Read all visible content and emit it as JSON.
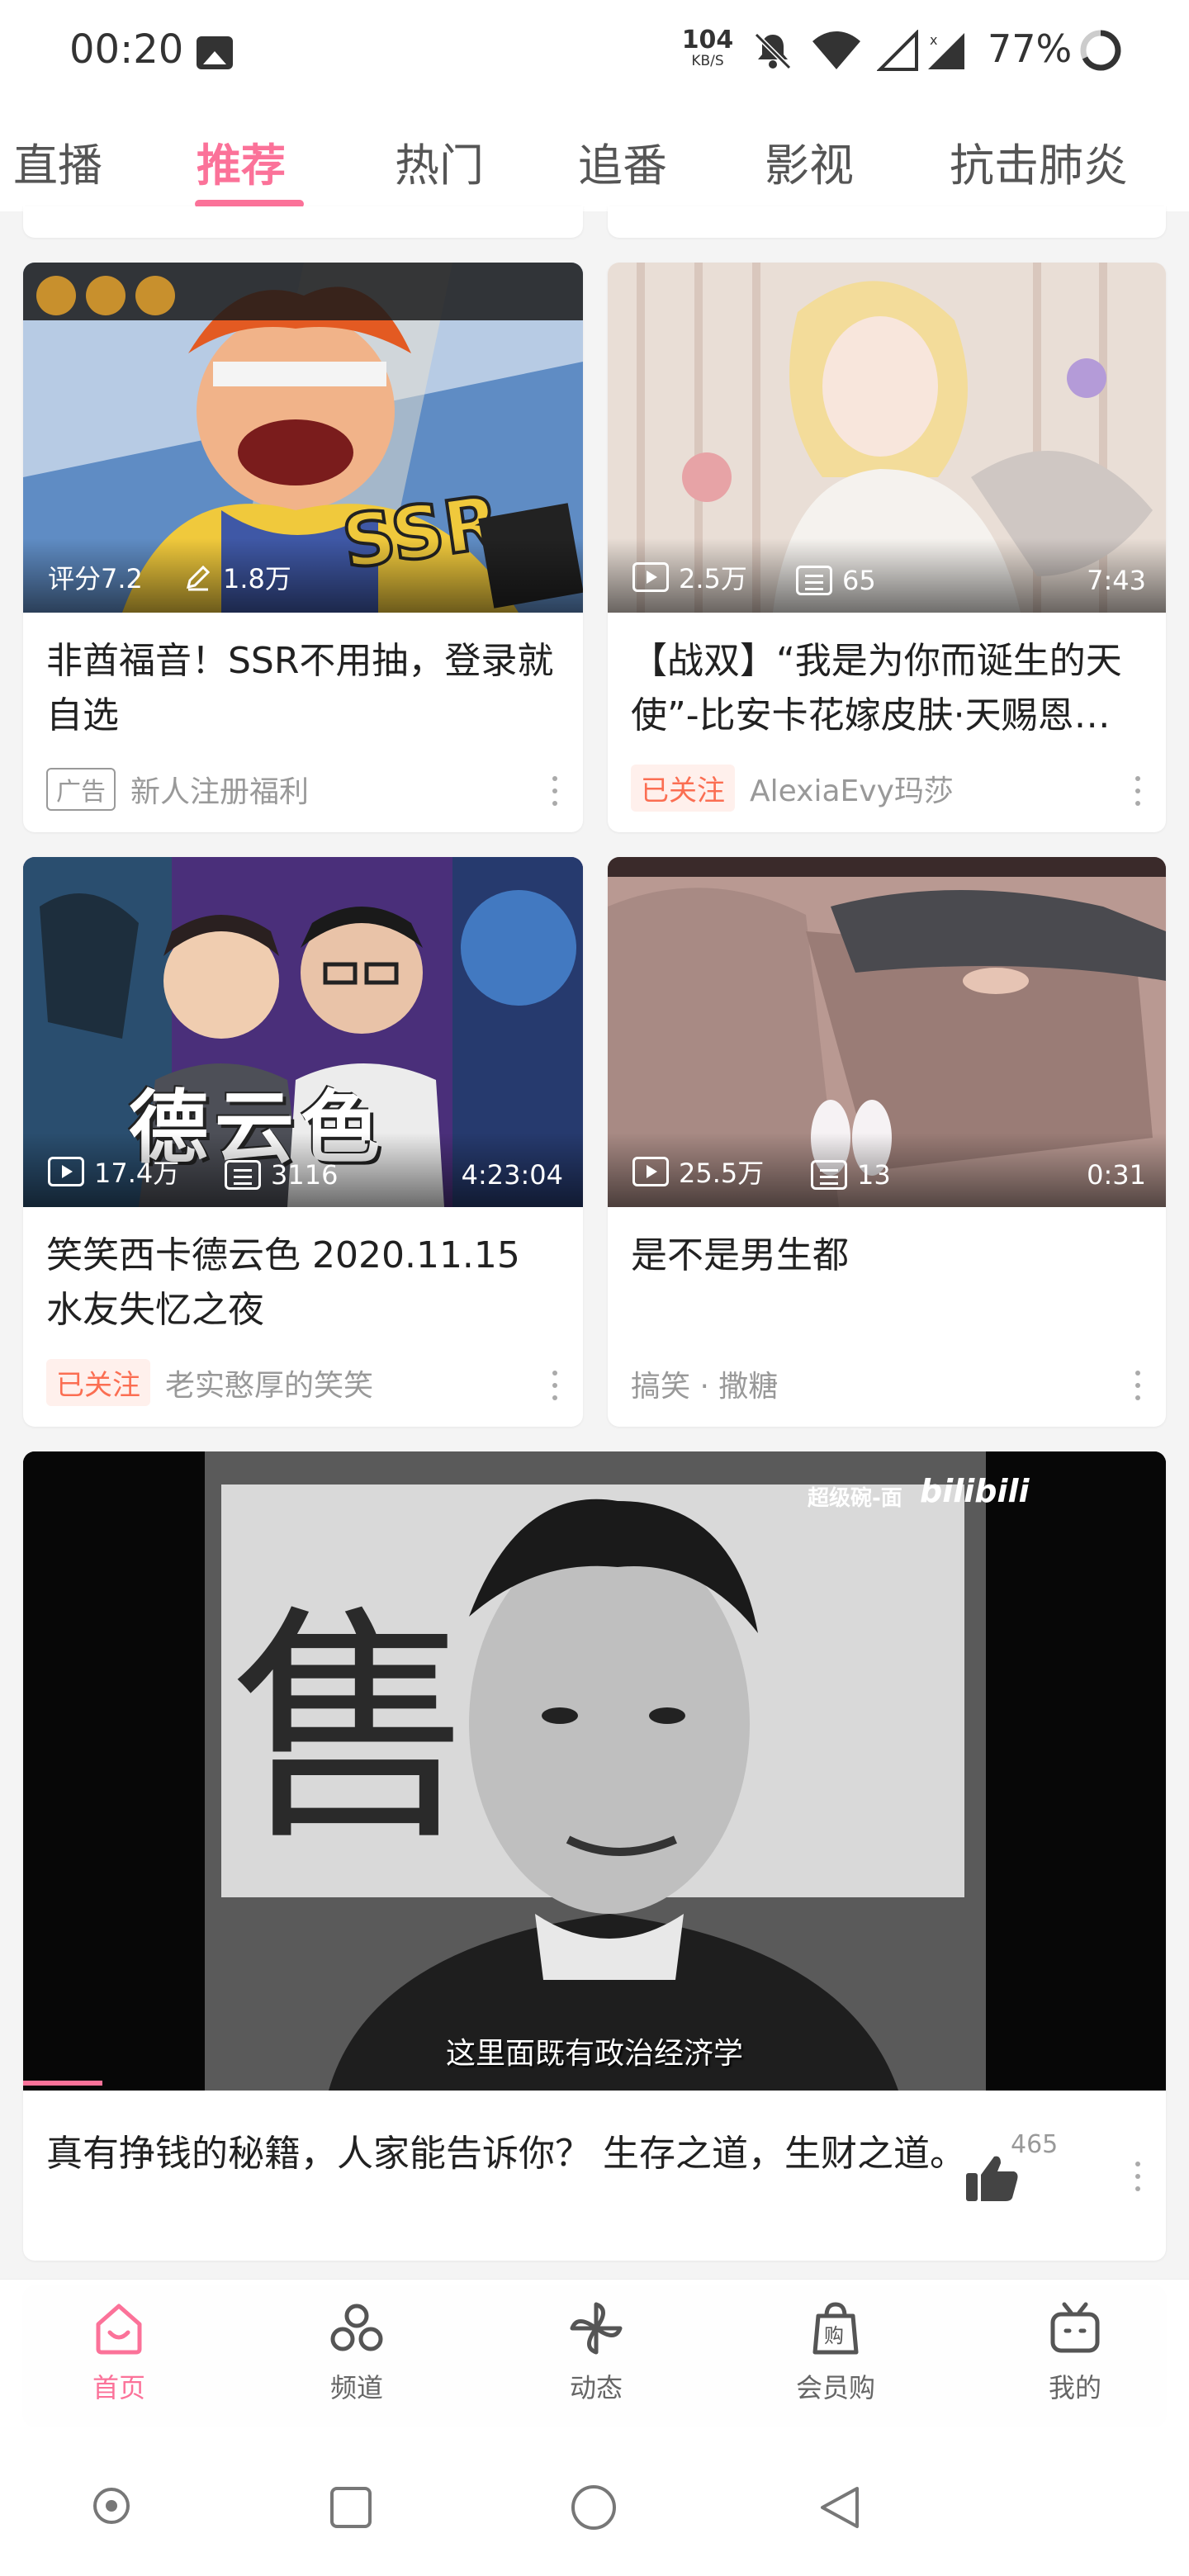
{
  "status_bar": {
    "time": "00:20",
    "net_speed_value": "104",
    "net_speed_unit": "KB/S",
    "battery": "77%"
  },
  "tabs": [
    {
      "label": "直播"
    },
    {
      "label": "推荐"
    },
    {
      "label": "热门"
    },
    {
      "label": "追番"
    },
    {
      "label": "影视"
    },
    {
      "label": "抗击肺炎"
    }
  ],
  "active_tab": "推荐",
  "cards": {
    "ad": {
      "rating": "评分7.2",
      "downloads": "1.8万",
      "title": "非酋福音！SSR不用抽，登录就自选",
      "badge": "广告",
      "source": "新人注册福利"
    },
    "zhanshuang": {
      "views": "2.5万",
      "danmaku": "65",
      "duration": "7:43",
      "title": "【战双】“我是为你而诞生的天使”-比安卡花嫁皮肤·天赐恩…",
      "badge": "已关注",
      "author": "AlexiaEvy玛莎"
    },
    "deyunse": {
      "views": "17.4万",
      "danmaku": "3116",
      "duration": "4:23:04",
      "thumb_text": "德云色",
      "title": "笑笑西卡德云色 2020.11.15 水友失忆之夜",
      "badge": "已关注",
      "author": "老实憨厚的笑笑"
    },
    "boys": {
      "views": "25.5万",
      "danmaku": "13",
      "duration": "0:31",
      "title": "是不是男生都",
      "category": "搞笑 · 撒糖"
    },
    "big": {
      "watermark": "超级碗-面",
      "watermark_logo": "bilibili",
      "subtitle": "这里面既有政治经济学",
      "title": "真有挣钱的秘籍，人家能告诉你？ 生存之道，生财之道。",
      "likes": "465"
    }
  },
  "bottom_nav": [
    {
      "label": "首页",
      "icon": "home-icon"
    },
    {
      "label": "频道",
      "icon": "channel-icon"
    },
    {
      "label": "动态",
      "icon": "pinwheel-icon"
    },
    {
      "label": "会员购",
      "icon": "shopping-bag-icon"
    },
    {
      "label": "我的",
      "icon": "tv-icon"
    }
  ],
  "colors": {
    "accent": "#fb7299",
    "follow_badge": "#fb6e52"
  }
}
